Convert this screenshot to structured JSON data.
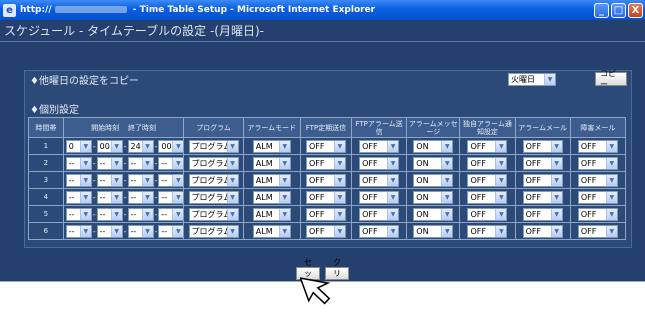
{
  "window": {
    "title_prefix": "http://",
    "title_suffix": " - Time Table Setup - Microsoft Internet Explorer",
    "min": "_",
    "max": "□",
    "close": "X"
  },
  "page": {
    "title": "スケジュール - タイムテーブルの設定 -(月曜日)-"
  },
  "copy": {
    "label": "♦他曜日の設定をコピー",
    "day_value": "火曜日",
    "button": "コピー"
  },
  "individual": {
    "label": "♦個別設定"
  },
  "table": {
    "headers": {
      "slot": "時間帯",
      "start": "開始時刻",
      "end": "終了時刻",
      "program": "プログラム",
      "alarm_mode": "アラームモード",
      "ftp_periodic": "FTP定期送信",
      "ftp_alarm": "FTPアラーム送信",
      "alarm_msg": "アラームメッセージ",
      "own_alarm": "独自アラーム通知設定",
      "alarm_mail": "アラームメール",
      "fault_mail": "障害メール"
    },
    "rows": [
      {
        "slot": "1",
        "sh": "0",
        "sm": "00",
        "eh": "24",
        "em": "00",
        "program": "プログラム1",
        "alarm_mode": "ALM",
        "ftp_periodic": "OFF",
        "ftp_alarm": "OFF",
        "alarm_msg": "ON",
        "own_alarm": "OFF",
        "alarm_mail": "OFF",
        "fault_mail": "OFF"
      },
      {
        "slot": "2",
        "sh": "--",
        "sm": "--",
        "eh": "--",
        "em": "--",
        "program": "プログラム1",
        "alarm_mode": "ALM",
        "ftp_periodic": "OFF",
        "ftp_alarm": "OFF",
        "alarm_msg": "ON",
        "own_alarm": "OFF",
        "alarm_mail": "OFF",
        "fault_mail": "OFF"
      },
      {
        "slot": "3",
        "sh": "--",
        "sm": "--",
        "eh": "--",
        "em": "--",
        "program": "プログラム1",
        "alarm_mode": "ALM",
        "ftp_periodic": "OFF",
        "ftp_alarm": "OFF",
        "alarm_msg": "ON",
        "own_alarm": "OFF",
        "alarm_mail": "OFF",
        "fault_mail": "OFF"
      },
      {
        "slot": "4",
        "sh": "--",
        "sm": "--",
        "eh": "--",
        "em": "--",
        "program": "プログラム1",
        "alarm_mode": "ALM",
        "ftp_periodic": "OFF",
        "ftp_alarm": "OFF",
        "alarm_msg": "ON",
        "own_alarm": "OFF",
        "alarm_mail": "OFF",
        "fault_mail": "OFF"
      },
      {
        "slot": "5",
        "sh": "--",
        "sm": "--",
        "eh": "--",
        "em": "--",
        "program": "プログラム1",
        "alarm_mode": "ALM",
        "ftp_periodic": "OFF",
        "ftp_alarm": "OFF",
        "alarm_msg": "ON",
        "own_alarm": "OFF",
        "alarm_mail": "OFF",
        "fault_mail": "OFF"
      },
      {
        "slot": "6",
        "sh": "--",
        "sm": "--",
        "eh": "--",
        "em": "--",
        "program": "プログラム1",
        "alarm_mode": "ALM",
        "ftp_periodic": "OFF",
        "ftp_alarm": "OFF",
        "alarm_msg": "ON",
        "own_alarm": "OFF",
        "alarm_mail": "OFF",
        "fault_mail": "OFF"
      }
    ]
  },
  "buttons": {
    "set": "セット",
    "clear": "クリア"
  },
  "colors": {
    "background": "#24406e",
    "panel": "#2c4a78",
    "header": "#3d5d8e",
    "titlebar": "#0a5fe0"
  },
  "icons": {
    "browser": "ie-icon",
    "dropdown": "chevron-down-icon",
    "pointer": "cursor-arrow-icon"
  }
}
